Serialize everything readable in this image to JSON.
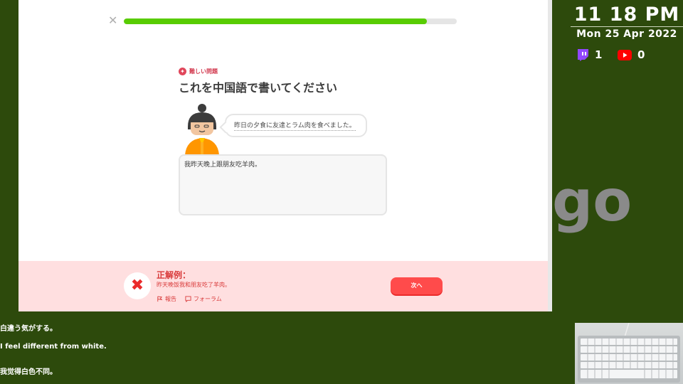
{
  "lesson": {
    "progress_percent": 91,
    "badge": "難しい問題",
    "title": "これを中国語で書いてください",
    "prompt": "昨日の夕食に友達とラム肉を食べました。",
    "answer_text": "我昨天晚上跟朋友吃羊肉。"
  },
  "feedback": {
    "heading": "正解例：",
    "correct_answer": "昨天晚饭我和朋友吃了羊肉。",
    "report_label": "報告",
    "forum_label": "フォーラム",
    "next_label": "次へ"
  },
  "overlay": {
    "time": "11 18 PM",
    "date": "Mon 25 Apr 2022",
    "twitch_count": "1",
    "youtube_count": "0",
    "watermark": "go",
    "captions": [
      "白違う気がする。",
      "I feel different from white.",
      "我觉得白色不同。"
    ]
  },
  "colors": {
    "progress": "#58cc02",
    "error_red": "#ff4b4b",
    "feedback_bg": "#ffdfe0",
    "background": "#2d4a0c"
  }
}
